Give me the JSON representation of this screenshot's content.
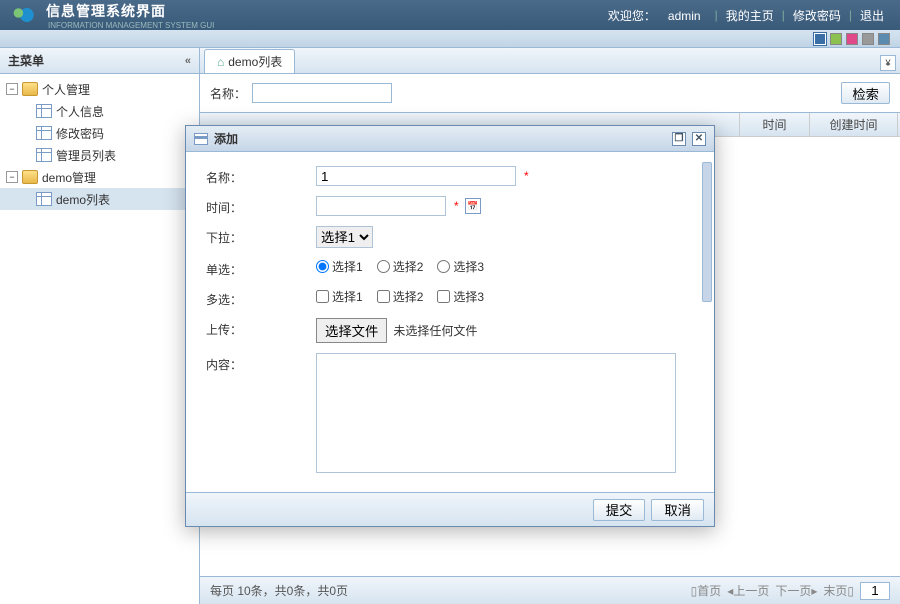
{
  "header": {
    "title": "信息管理系统界面",
    "subtitle": "INFORMATION MANAGEMENT SYSTEM GUI",
    "welcome_prefix": "欢迎您：",
    "username": "admin",
    "links": {
      "home": "我的主页",
      "password": "修改密码",
      "logout": "退出"
    }
  },
  "theme_colors": [
    "#3b6ea5",
    "#8cc152",
    "#e04a8a",
    "#999999",
    "#5a8ab0"
  ],
  "sidebar": {
    "title": "主菜单",
    "nodes": [
      {
        "label": "个人管理",
        "children": [
          "个人信息",
          "修改密码",
          "管理员列表"
        ]
      },
      {
        "label": "demo管理",
        "children": [
          "demo列表"
        ]
      }
    ]
  },
  "tab": {
    "label": "demo列表"
  },
  "filter": {
    "label": "名称：",
    "search_btn": "检索"
  },
  "columns": {
    "time": "时间",
    "created": "创建时间"
  },
  "pager": {
    "text": "每页 10条，共0条，共0页",
    "first": "首页",
    "prev": "上一页",
    "next": "下一页",
    "last": "末页",
    "page_value": "1"
  },
  "dialog": {
    "title": "添加",
    "fields": {
      "name": {
        "label": "名称：",
        "value": "1"
      },
      "time": {
        "label": "时间：",
        "value": ""
      },
      "select": {
        "label": "下拉：",
        "options": [
          "选择1"
        ],
        "value": "选择1"
      },
      "radio": {
        "label": "单选：",
        "options": [
          "选择1",
          "选择2",
          "选择3"
        ],
        "checked": "选择1"
      },
      "checkbox": {
        "label": "多选：",
        "options": [
          "选择1",
          "选择2",
          "选择3"
        ]
      },
      "upload": {
        "label": "上传：",
        "button": "选择文件",
        "status": "未选择任何文件"
      },
      "content": {
        "label": "内容：",
        "value": ""
      }
    },
    "buttons": {
      "submit": "提交",
      "cancel": "取消"
    }
  }
}
